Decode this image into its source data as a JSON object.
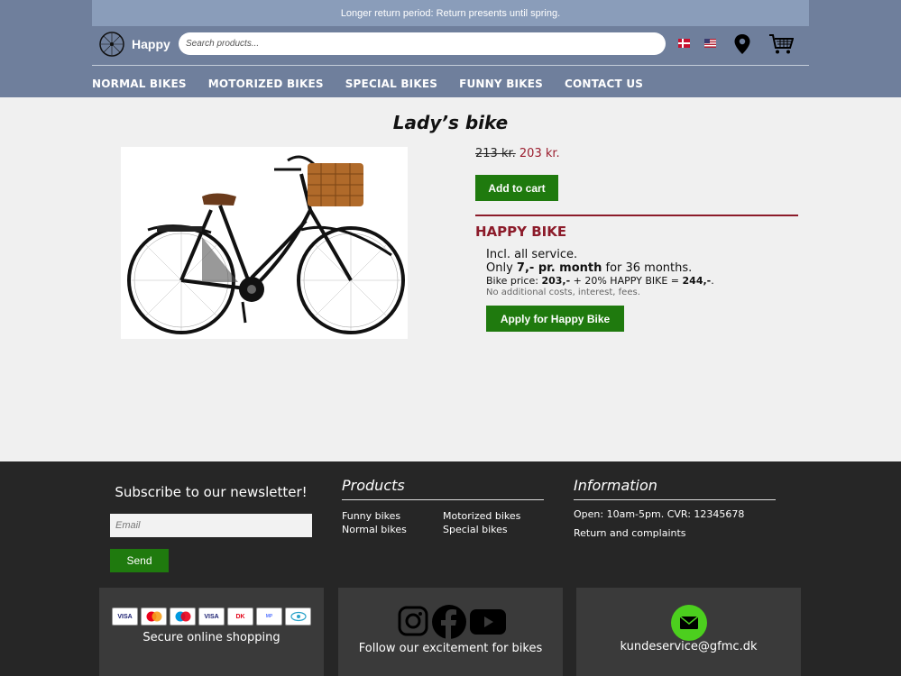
{
  "header": {
    "banner": "Longer return period: Return presents until spring.",
    "logo_text": "Happy",
    "search_placeholder": "Search products..."
  },
  "nav": [
    "NORMAL BIKES",
    "MOTORIZED BIKES",
    "SPECIAL BIKES",
    "FUNNY BIKES",
    "CONTACT US"
  ],
  "product": {
    "title": "Lady’s bike",
    "old_price": "213 kr.",
    "new_price": "203 kr.",
    "add_to_cart": "Add to cart"
  },
  "happy_bike": {
    "title": "HAPPY BIKE",
    "line1": "Incl. all service.",
    "line2_prefix": "Only ",
    "line2_bold": "7,- pr. month",
    "line2_suffix": " for 36 months.",
    "line3_prefix": "Bike price: ",
    "line3_bold1": "203,-",
    "line3_mid": " + 20% HAPPY BIKE = ",
    "line3_bold2": "244,-",
    "line3_suffix": ".",
    "line4": "No additional costs, interest, fees.",
    "apply": "Apply for Happy Bike"
  },
  "footer": {
    "newsletter_title": "Subscribe to our newsletter!",
    "email_placeholder": "Email",
    "send": "Send",
    "products_title": "Products",
    "products": [
      "Funny bikes",
      "Normal bikes",
      "Motorized bikes",
      "Special bikes"
    ],
    "info_title": "Information",
    "info_line": "Open: 10am-5pm. CVR: 12345678",
    "returns": "Return and complaints",
    "secure": "Secure online shopping",
    "follow": "Follow our excitement for bikes",
    "email": "kundeservice@gfmc.dk",
    "cards": [
      "VISA",
      "MC",
      "MAESTRO",
      "VISA",
      "DK",
      "MOBILEPAY",
      "EYE"
    ]
  },
  "colors": {
    "header_bg": "#6f7f9c",
    "banner_bg": "#8a9dba",
    "price_red": "#9b1d2e",
    "button_green": "#1f7a0e",
    "footer_bg": "#262626"
  }
}
